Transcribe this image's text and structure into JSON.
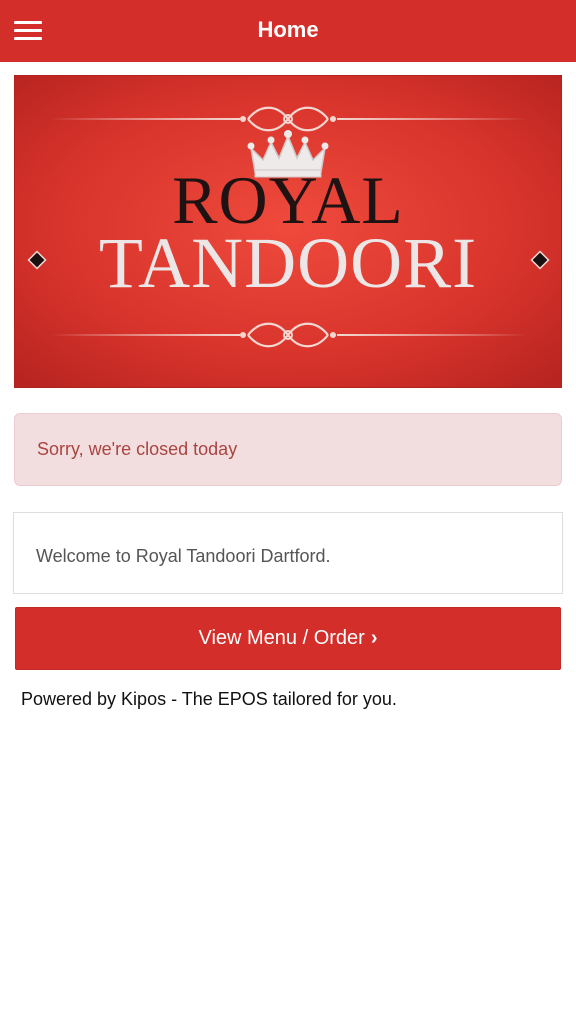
{
  "header": {
    "title": "Home",
    "menu_icon": "hamburger-menu-icon",
    "background_color": "#d42e2b"
  },
  "banner": {
    "line1": "ROYAL",
    "line2": "TANDOORI",
    "background_color": "#d63a2f",
    "crown_icon": "crown-icon"
  },
  "notice": {
    "text": "Sorry, we're closed today"
  },
  "welcome": {
    "text": "Welcome to Royal Tandoori Dartford."
  },
  "order_button": {
    "label": "View Menu / Order",
    "chevron": "›"
  },
  "footer": {
    "powered_by": "Powered by Kipos - The EPOS tailored for you."
  }
}
